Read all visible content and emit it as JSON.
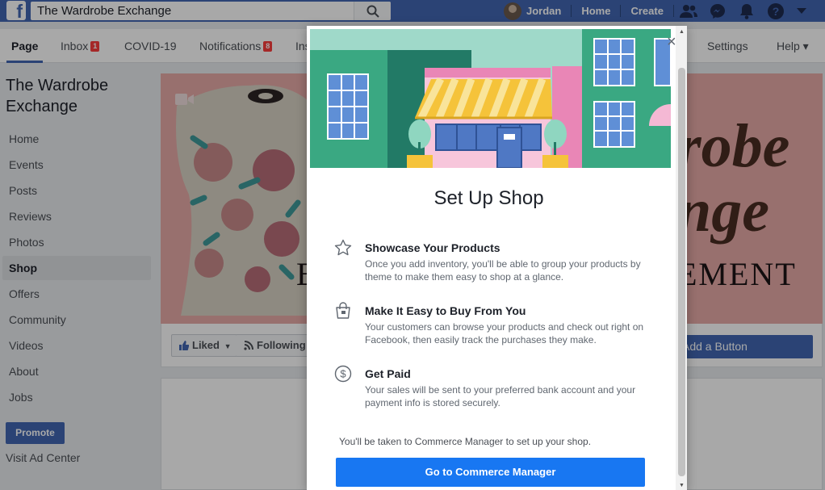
{
  "topbar": {
    "search_value": "The Wardrobe Exchange",
    "user_name": "Jordan",
    "home_label": "Home",
    "create_label": "Create"
  },
  "tabs": {
    "page": "Page",
    "inbox": "Inbox",
    "inbox_badge": "1",
    "covid": "COVID-19",
    "notifications": "Notifications",
    "notifications_badge": "8",
    "insights": "Insights",
    "settings": "Settings",
    "help": "Help ▾"
  },
  "sidebar": {
    "page_title": "The Wardrobe Exchange",
    "items": [
      "Home",
      "Events",
      "Posts",
      "Reviews",
      "Photos",
      "Shop",
      "Offers",
      "Community",
      "Videos",
      "About",
      "Jobs"
    ],
    "active_item": "Shop",
    "promote": "Promote",
    "visit_ad_center": "Visit Ad Center"
  },
  "cover": {
    "liked": "Liked",
    "following": "Following",
    "add_button": "Add a Button",
    "text_right": "robe\nnge",
    "text_bottom": "EMENT",
    "text_left": "B"
  },
  "dialog": {
    "title": "Set Up Shop",
    "features": [
      {
        "icon": "star-icon",
        "title": "Showcase Your Products",
        "desc": "Once you add inventory, you'll be able to group your products by theme to make them easy to shop at a glance."
      },
      {
        "icon": "shopping-bag-icon",
        "title": "Make It Easy to Buy From You",
        "desc": "Your customers can browse your products and check out right on Facebook, then easily track the purchases they make."
      },
      {
        "icon": "dollar-circle-icon",
        "title": "Get Paid",
        "desc": "Your sales will be sent to your preferred bank account and your payment info is stored securely."
      }
    ],
    "note": "You'll be taken to Commerce Manager to set up your shop.",
    "cta": "Go to Commerce Manager"
  },
  "colors": {
    "fb_blue": "#4267b2",
    "cta_blue": "#1877f2",
    "badge_red": "#fa3e3e",
    "cover_pink": "#e7aaa8"
  }
}
